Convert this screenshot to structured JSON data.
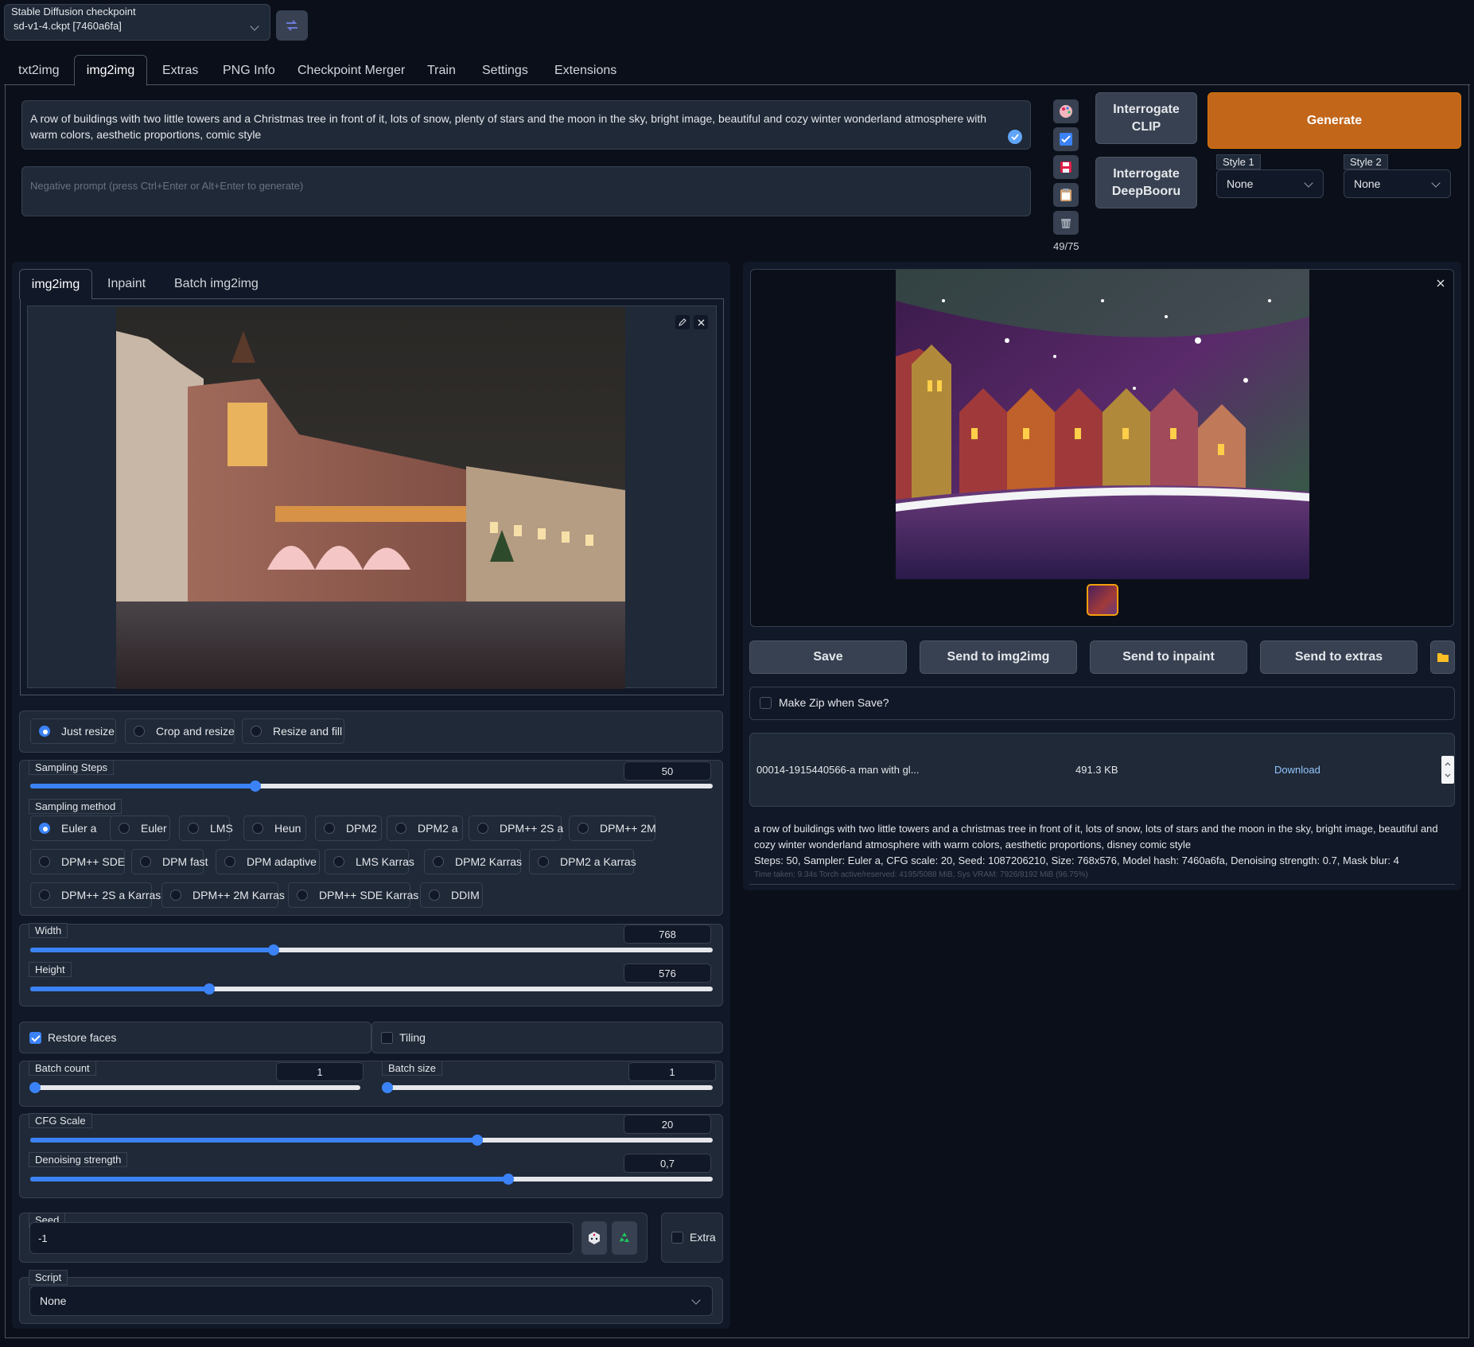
{
  "checkpoint": {
    "label": "Stable Diffusion checkpoint",
    "value": "sd-v1-4.ckpt [7460a6fa]"
  },
  "main_tabs": [
    "txt2img",
    "img2img",
    "Extras",
    "PNG Info",
    "Checkpoint Merger",
    "Train",
    "Settings",
    "Extensions"
  ],
  "active_main_tab": "img2img",
  "prompt": {
    "text": "A row of buildings with two little towers and a Christmas tree in front of it, lots of snow, plenty of stars and the moon in the sky, bright image, beautiful and cozy winter wonderland atmosphere with warm colors, aesthetic proportions, comic style",
    "negative_placeholder": "Negative prompt (press Ctrl+Enter or Alt+Enter to generate)",
    "token_count": "49/75"
  },
  "buttons": {
    "interrogate_clip": "Interrogate CLIP",
    "interrogate_deepbooru": "Interrogate DeepBooru",
    "generate": "Generate"
  },
  "styles": {
    "style1_label": "Style 1",
    "style1_value": "None",
    "style2_label": "Style 2",
    "style2_value": "None"
  },
  "sub_tabs": [
    "img2img",
    "Inpaint",
    "Batch img2img"
  ],
  "resize_modes": [
    "Just resize",
    "Crop and resize",
    "Resize and fill"
  ],
  "selected_resize_mode": "Just resize",
  "sampling_steps": {
    "label": "Sampling Steps",
    "value": "50",
    "fraction": 0.33
  },
  "sampling_method": {
    "label": "Sampling method",
    "options": [
      "Euler a",
      "Euler",
      "LMS",
      "Heun",
      "DPM2",
      "DPM2 a",
      "DPM++ 2S a",
      "DPM++ 2M",
      "DPM++ SDE",
      "DPM fast",
      "DPM adaptive",
      "LMS Karras",
      "DPM2 Karras",
      "DPM2 a Karras",
      "DPM++ 2S a Karras",
      "DPM++ 2M Karras",
      "DPM++ SDE Karras",
      "DDIM"
    ],
    "selected": "Euler a"
  },
  "width": {
    "label": "Width",
    "value": "768",
    "fraction": 0.357
  },
  "height": {
    "label": "Height",
    "value": "576",
    "fraction": 0.262
  },
  "restore_faces": {
    "label": "Restore faces",
    "checked": true
  },
  "tiling": {
    "label": "Tiling",
    "checked": false
  },
  "batch_count": {
    "label": "Batch count",
    "value": "1",
    "fraction": 0.0
  },
  "batch_size": {
    "label": "Batch size",
    "value": "1",
    "fraction": 0.0
  },
  "cfg_scale": {
    "label": "CFG Scale",
    "value": "20",
    "fraction": 0.655
  },
  "denoising_strength": {
    "label": "Denoising strength",
    "value": "0,7",
    "fraction": 0.7
  },
  "seed": {
    "label": "Seed",
    "value": "-1",
    "extra_label": "Extra"
  },
  "script": {
    "label": "Script",
    "value": "None"
  },
  "output": {
    "buttons": [
      "Save",
      "Send to img2img",
      "Send to inpaint",
      "Send to extras"
    ],
    "make_zip_label": "Make Zip when Save?",
    "file_name": "00014-1915440566-a man with gl...",
    "file_size": "491.3 KB",
    "download_label": "Download",
    "info_prompt": "a row of buildings with two little towers and a christmas tree in front of it, lots of snow, lots of stars and the moon in the sky, bright image, beautiful and cozy winter wonderland atmosphere with warm colors, aesthetic proportions, disney comic style",
    "info_params": "Steps: 50, Sampler: Euler a, CFG scale: 20, Seed: 1087206210, Size: 768x576, Model hash: 7460a6fa, Denoising strength: 0.7, Mask blur: 4",
    "info_time": "Time taken: 9.34s  Torch active/reserved: 4195/5088 MiB, Sys VRAM: 7926/8192 MiB (96.75%)"
  },
  "colors": {
    "accent": "#3b82f6",
    "generate": "#c2661a",
    "background": "#0b0f19",
    "panel": "#1f2937"
  }
}
